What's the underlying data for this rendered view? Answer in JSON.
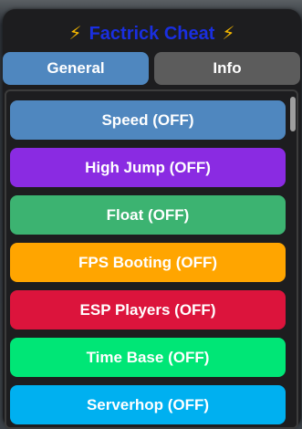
{
  "title": {
    "text": "Factrick Cheat",
    "left_icon": "lightning-icon",
    "right_icon": "lightning-icon",
    "bolt_glyph": "⚡"
  },
  "tabs": [
    {
      "label": "General",
      "color": "#4f87bf"
    },
    {
      "label": "Info",
      "color": "#5c5c5c"
    }
  ],
  "toggles": [
    {
      "label": "Speed (OFF)",
      "color": "#4f87bf"
    },
    {
      "label": "High Jump (OFF)",
      "color": "#8a2be2"
    },
    {
      "label": "Float (OFF)",
      "color": "#3cb371"
    },
    {
      "label": "FPS Booting (OFF)",
      "color": "#ffa500"
    },
    {
      "label": "ESP Players (OFF)",
      "color": "#dc143c"
    },
    {
      "label": "Time Base (OFF)",
      "color": "#00e676"
    },
    {
      "label": "Serverhop (OFF)",
      "color": "#00b0f0"
    }
  ]
}
